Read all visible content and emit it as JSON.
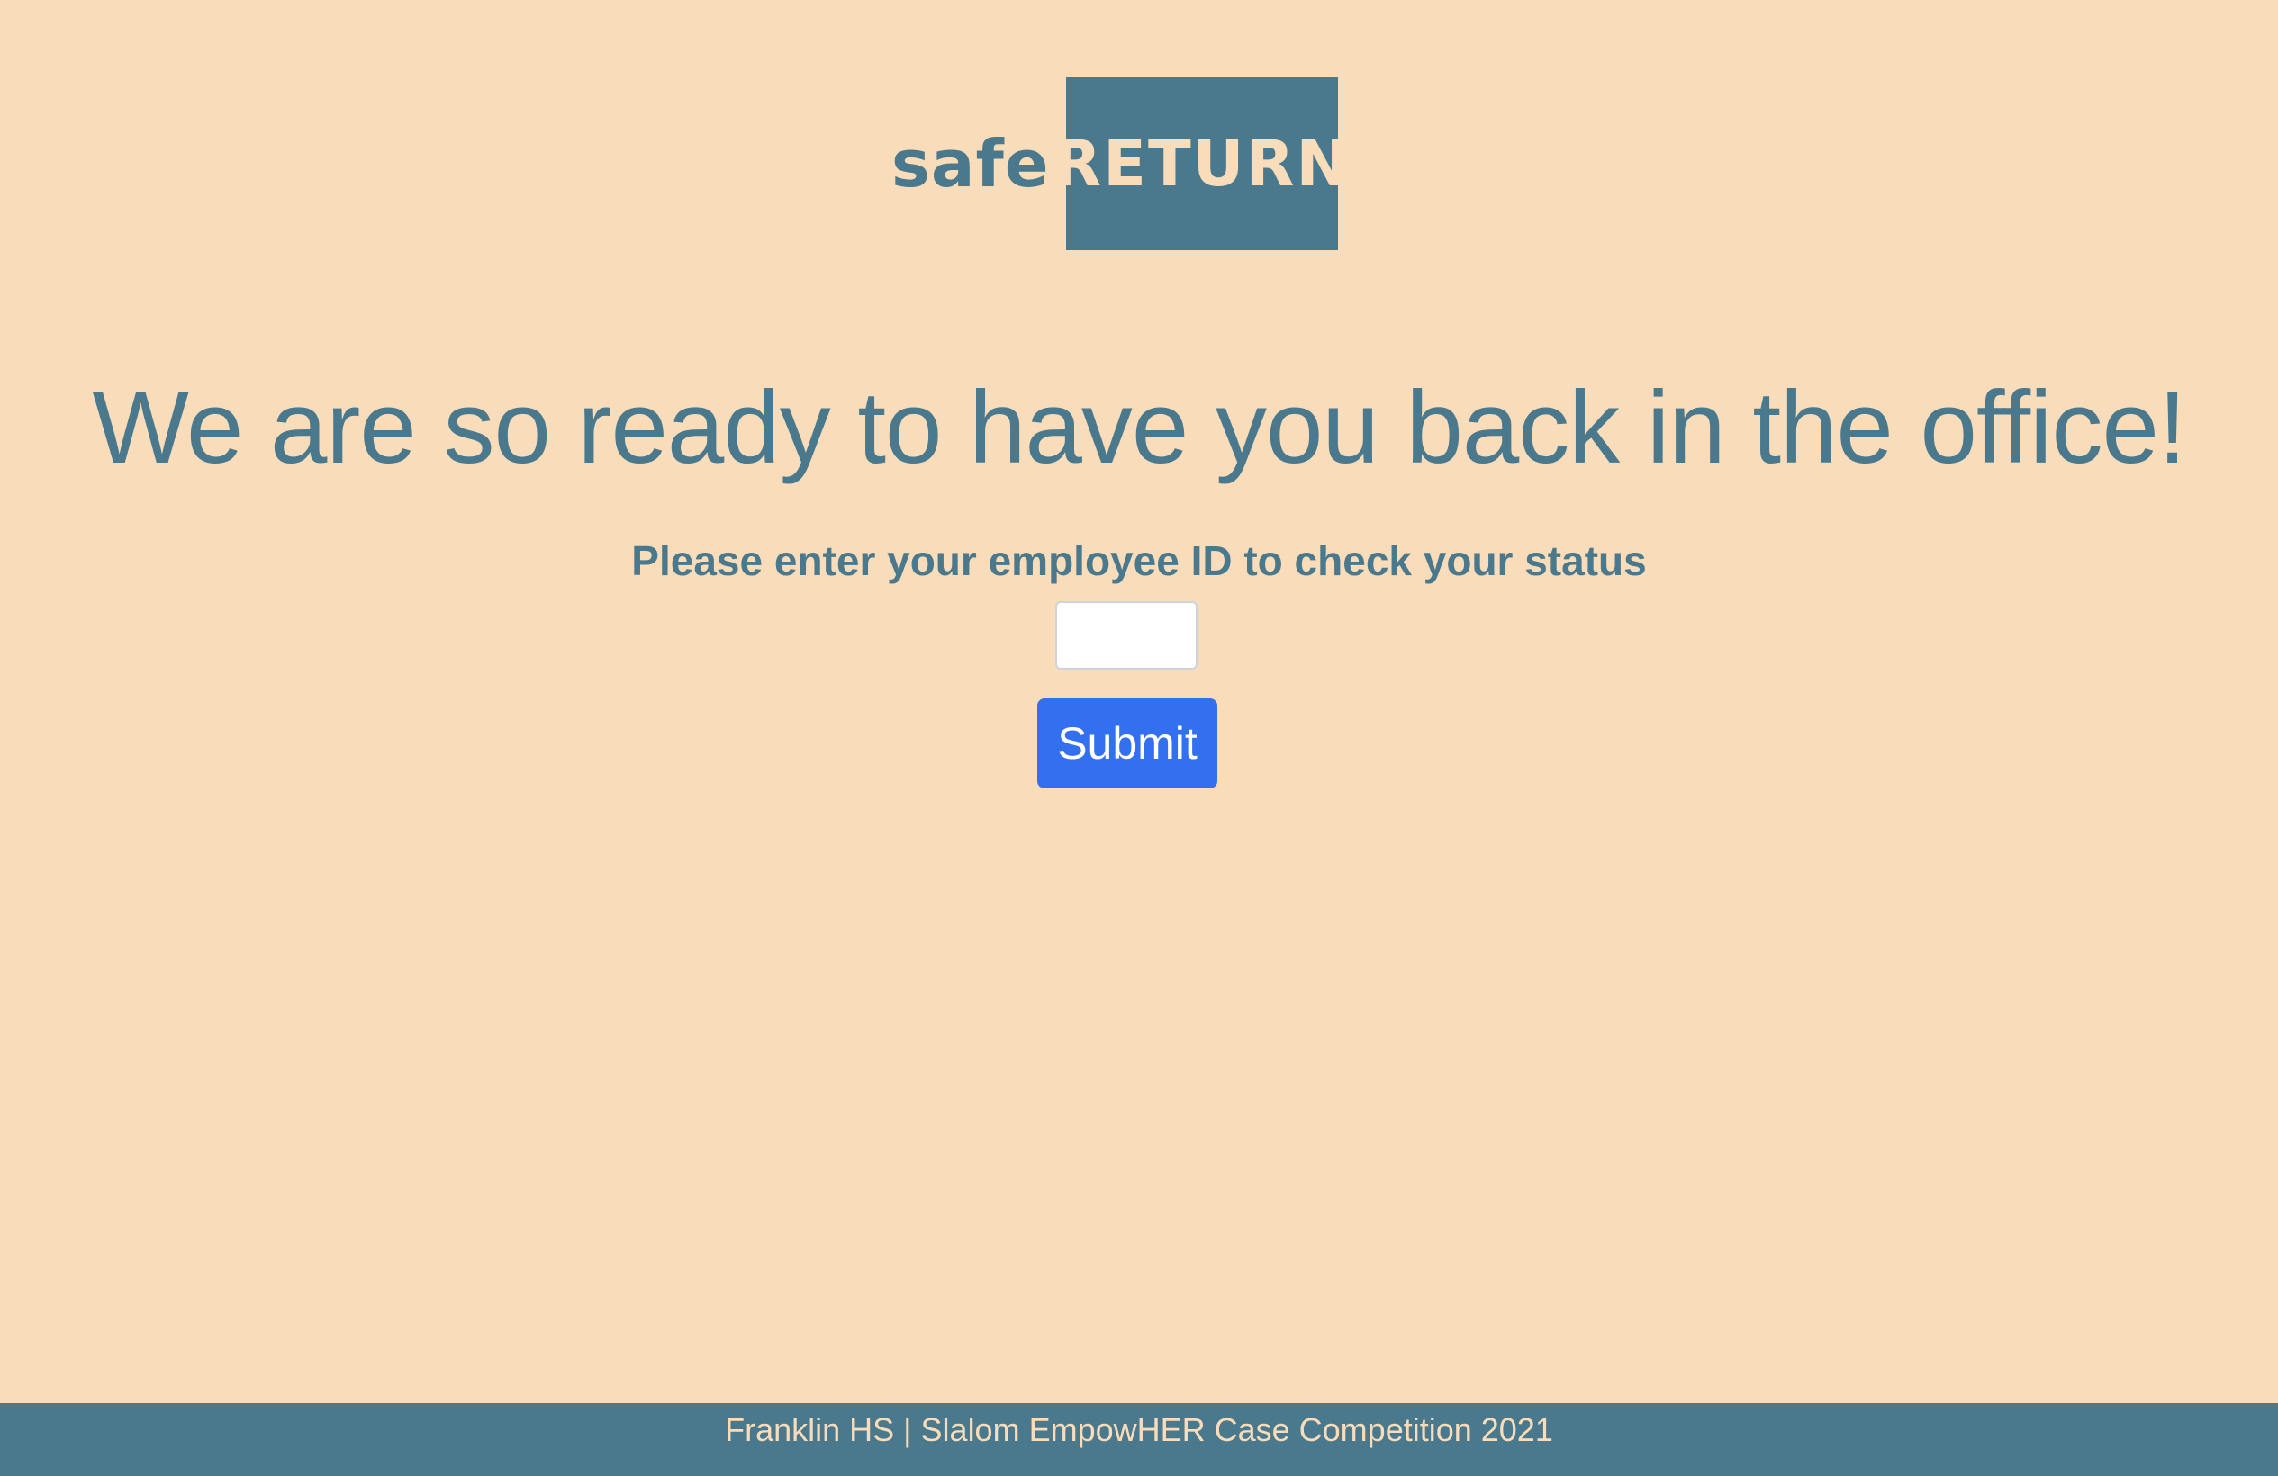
{
  "brand": {
    "logo_prefix": "safe",
    "logo_suffix": "RETURN",
    "primary_color": "#4A788C",
    "background_color": "#F9DDBA"
  },
  "main": {
    "headline": "We are so ready to have you back in the office!",
    "prompt": "Please enter your employee ID to check your status",
    "employee_id_input": {
      "value": "",
      "placeholder": ""
    },
    "submit_label": "Submit",
    "submit_color": "#3370F0"
  },
  "footer": {
    "text": "Franklin HS | Slalom EmpowHER Case Competition 2021"
  }
}
